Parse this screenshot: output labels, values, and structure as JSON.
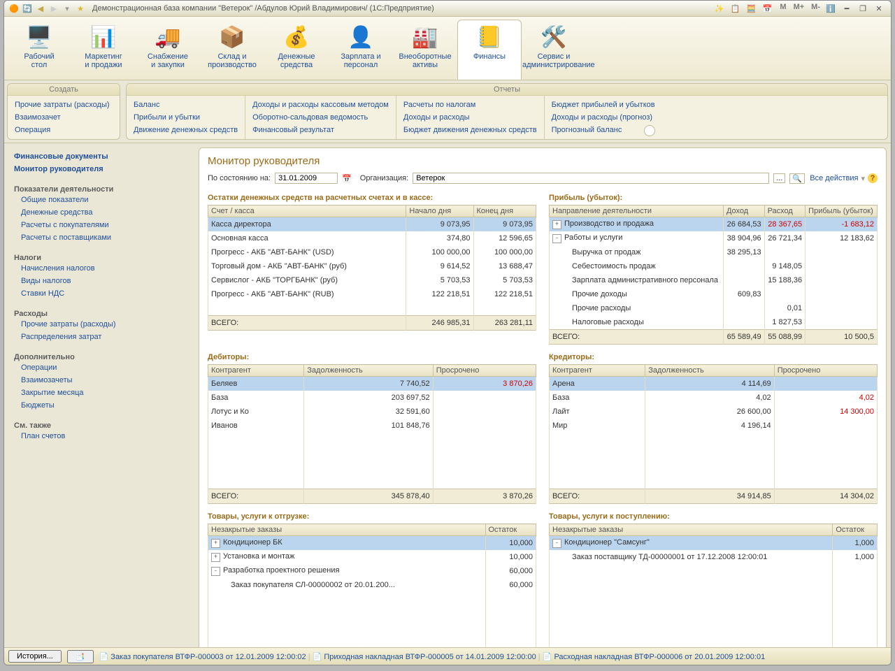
{
  "title": "Демонстрационная база компании \"Ветерок\" /Абдулов Юрий Владимирович/  (1С:Предприятие)",
  "mem_btns": [
    "M",
    "M+",
    "M-"
  ],
  "ribbon": [
    {
      "label": "Рабочий\nстол"
    },
    {
      "label": "Маркетинг\nи продажи"
    },
    {
      "label": "Снабжение\nи закупки"
    },
    {
      "label": "Склад и\nпроизводство"
    },
    {
      "label": "Денежные\nсредства"
    },
    {
      "label": "Зарплата и\nперсонал"
    },
    {
      "label": "Внеоборотные\nактивы"
    },
    {
      "label": "Финансы",
      "active": true
    },
    {
      "label": "Сервис и\nадминистрирование"
    }
  ],
  "create": {
    "hdr": "Создать",
    "cols": [
      [
        "Прочие затраты (расходы)",
        "Взаимозачет",
        "Операция"
      ]
    ]
  },
  "reports": {
    "hdr": "Отчеты",
    "cols": [
      [
        "Баланс",
        "Прибыли и убытки",
        "Движение денежных средств"
      ],
      [
        "Доходы и расходы кассовым методом",
        "Оборотно-сальдовая ведомость",
        "Финансовый результат"
      ],
      [
        "Расчеты по налогам",
        "Доходы и расходы",
        "Бюджет движения денежных средств"
      ],
      [
        "Бюджет прибылей и убытков",
        "Доходы и расходы (прогноз)",
        "Прогнозный баланс"
      ]
    ]
  },
  "sidebar": {
    "top": [
      "Финансовые документы",
      "Монитор руководителя"
    ],
    "groups": [
      {
        "t": "Показатели деятельности",
        "items": [
          "Общие показатели",
          "Денежные средства",
          "Расчеты с покупателями",
          "Расчеты с поставщиками"
        ]
      },
      {
        "t": "Налоги",
        "items": [
          "Начисления налогов",
          "Виды налогов",
          "Ставки НДС"
        ]
      },
      {
        "t": "Расходы",
        "items": [
          "Прочие затраты (расходы)",
          "Распределения затрат"
        ]
      },
      {
        "t": "Дополнительно",
        "items": [
          "Операции",
          "Взаимозачеты",
          "Закрытие месяца",
          "Бюджеты"
        ]
      },
      {
        "t": "См. также",
        "items": [
          "План счетов"
        ]
      }
    ]
  },
  "main": {
    "heading": "Монитор руководителя",
    "filter": {
      "date_lbl": "По состоянию на:",
      "date_val": "31.01.2009",
      "org_lbl": "Организация:",
      "org_val": "Ветерок",
      "all_actions": "Все действия"
    },
    "cash": {
      "title": "Остатки денежных средств на расчетных счетах и в кассе:",
      "cols": [
        "Счет / касса",
        "Начало дня",
        "Конец дня"
      ],
      "rows": [
        {
          "n": "Касса директора",
          "a": "9 073,95",
          "b": "9 073,95",
          "sel": true
        },
        {
          "n": "Основная касса",
          "a": "374,80",
          "b": "12 596,65"
        },
        {
          "n": "Прогресс - АКБ \"АВТ-БАНК\" (USD)",
          "a": "100 000,00",
          "b": "100 000,00"
        },
        {
          "n": "Торговый дом - АКБ \"АВТ-БАНК\" (руб)",
          "a": "9 614,52",
          "b": "13 688,47"
        },
        {
          "n": "Сервислог - АКБ \"ТОРГБАНК\" (руб)",
          "a": "5 703,53",
          "b": "5 703,53"
        },
        {
          "n": "Прогресс - АКБ \"АВТ-БАНК\" (RUB)",
          "a": "122 218,51",
          "b": "122 218,51"
        }
      ],
      "total": {
        "l": "ВСЕГО:",
        "a": "246 985,31",
        "b": "263 281,11"
      }
    },
    "profit": {
      "title": "Прибыль (убыток):",
      "cols": [
        "Направление деятельности",
        "Доход",
        "Расход",
        "Прибыль (убыток)"
      ],
      "rows": [
        {
          "n": "Производство и продажа",
          "exp": "+",
          "a": "26 684,53",
          "b": "28 367,65",
          "c": "-1 683,12",
          "sel": true,
          "neg": true
        },
        {
          "n": "Работы и услуги",
          "exp": "-",
          "a": "38 904,96",
          "b": "26 721,34",
          "c": "12 183,62"
        },
        {
          "n": "Выручка от продаж",
          "ind": 2,
          "a": "38 295,13",
          "b": "",
          "c": ""
        },
        {
          "n": "Себестоимость продаж",
          "ind": 2,
          "a": "",
          "b": "9 148,05",
          "c": ""
        },
        {
          "n": "Зарплата административного персонала",
          "ind": 2,
          "a": "",
          "b": "15 188,36",
          "c": ""
        },
        {
          "n": "Прочие доходы",
          "ind": 2,
          "a": "609,83",
          "b": "",
          "c": ""
        },
        {
          "n": "Прочие расходы",
          "ind": 2,
          "a": "",
          "b": "0,01",
          "c": ""
        },
        {
          "n": "Налоговые расходы",
          "ind": 2,
          "a": "",
          "b": "1 827,53",
          "c": ""
        }
      ],
      "total": {
        "l": "ВСЕГО:",
        "a": "65 589,49",
        "b": "55 088,99",
        "c": "10 500,5"
      }
    },
    "debtors": {
      "title": "Дебиторы:",
      "cols": [
        "Контрагент",
        "Задолженность",
        "Просрочено"
      ],
      "rows": [
        {
          "n": "Беляев",
          "a": "7 740,52",
          "b": "3 870,26",
          "sel": true,
          "neg": true
        },
        {
          "n": "База",
          "a": "203 697,52",
          "b": ""
        },
        {
          "n": "Лотус и Ко",
          "a": "32 591,60",
          "b": ""
        },
        {
          "n": "Иванов",
          "a": "101 848,76",
          "b": ""
        }
      ],
      "total": {
        "l": "ВСЕГО:",
        "a": "345 878,40",
        "b": "3 870,26"
      }
    },
    "creditors": {
      "title": "Кредиторы:",
      "cols": [
        "Контрагент",
        "Задолженность",
        "Просрочено"
      ],
      "rows": [
        {
          "n": "Арена",
          "a": "4 114,69",
          "b": "",
          "sel": true
        },
        {
          "n": "База",
          "a": "4,02",
          "b": "4,02",
          "neg": true
        },
        {
          "n": "Лайт",
          "a": "26 600,00",
          "b": "14 300,00",
          "neg": true
        },
        {
          "n": "Мир",
          "a": "4 196,14",
          "b": ""
        }
      ],
      "total": {
        "l": "ВСЕГО:",
        "a": "34 914,85",
        "b": "14 304,02"
      }
    },
    "ship": {
      "title": "Товары, услуги к отгрузке:",
      "cols": [
        "Незакрытые заказы",
        "Остаток"
      ],
      "rows": [
        {
          "n": "Кондиционер БК",
          "exp": "+",
          "a": "10,000",
          "sel": true
        },
        {
          "n": "Установка и монтаж",
          "exp": "+",
          "a": "10,000"
        },
        {
          "n": "Разработка проектного решения",
          "exp": "-",
          "a": "60,000"
        },
        {
          "n": "Заказ покупателя СЛ-00000002 от 20.01.200...",
          "ind": 2,
          "a": "60,000"
        }
      ]
    },
    "receive": {
      "title": "Товары, услуги к поступлению:",
      "cols": [
        "Незакрытые заказы",
        "Остаток"
      ],
      "rows": [
        {
          "n": "Кондиционер \"Самсунг\"",
          "exp": "-",
          "a": "1,000",
          "sel": true
        },
        {
          "n": "Заказ поставщику ТД-00000001 от 17.12.2008 12:00:01",
          "ind": 2,
          "a": "1,000"
        }
      ]
    }
  },
  "status": {
    "history": "История...",
    "items": [
      "Заказ покупателя ВТФР-000003 от 12.01.2009 12:00:02",
      "Приходная накладная ВТФР-000005 от 14.01.2009 12:00:00",
      "Расходная накладная ВТФР-000006 от 20.01.2009 12:00:01"
    ]
  }
}
